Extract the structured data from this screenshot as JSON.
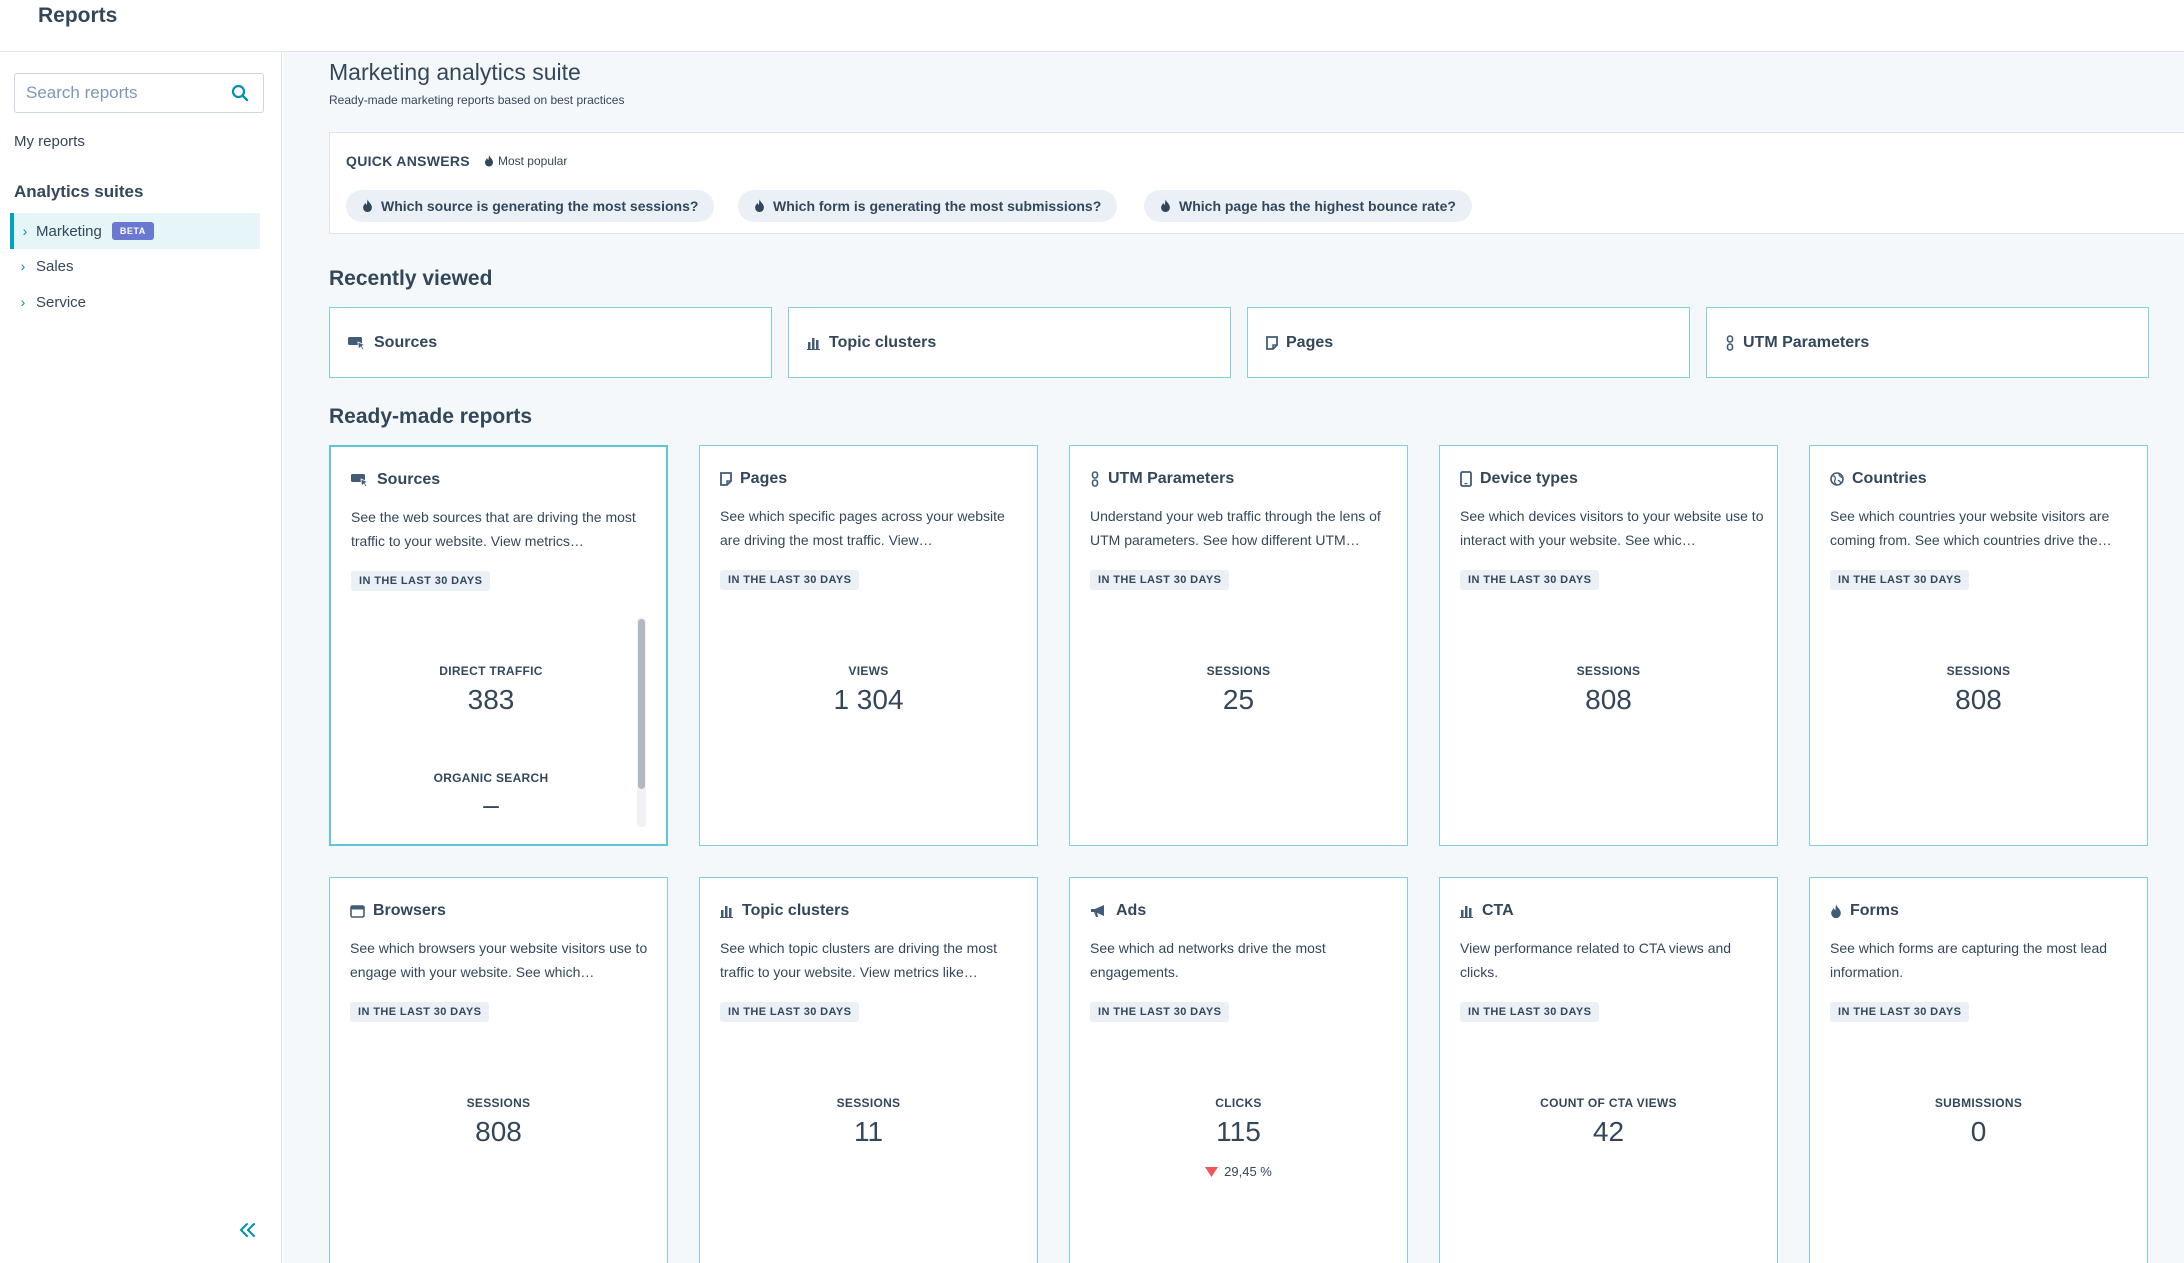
{
  "header": {
    "title": "Reports"
  },
  "sidebar": {
    "search_placeholder": "Search reports",
    "my_reports": "My reports",
    "suites_heading": "Analytics suites",
    "items": [
      {
        "label": "Marketing",
        "badge": "BETA"
      },
      {
        "label": "Sales"
      },
      {
        "label": "Service"
      }
    ]
  },
  "main": {
    "title": "Marketing analytics suite",
    "subtitle": "Ready-made marketing reports based on best practices",
    "quick_answers": {
      "heading": "QUICK ANSWERS",
      "popular": "Most popular",
      "chips": [
        "Which source is generating the most sessions?",
        "Which form is generating the most submissions?",
        "Which page has the highest bounce rate?"
      ]
    },
    "recently_viewed": {
      "heading": "Recently viewed",
      "items": [
        "Sources",
        "Topic clusters",
        "Pages",
        "UTM Parameters"
      ]
    },
    "ready_made": {
      "heading": "Ready-made reports",
      "period_badge": "IN THE LAST 30 DAYS",
      "cards": [
        {
          "icon": "sources-icon",
          "title": "Sources",
          "desc": "See the web sources that are driving the most traffic to your website. View metrics…",
          "metrics": [
            {
              "label": "DIRECT TRAFFIC",
              "value": "383"
            },
            {
              "label": "ORGANIC SEARCH",
              "value": "–"
            }
          ]
        },
        {
          "icon": "pages-icon",
          "title": "Pages",
          "desc": "See which specific pages across your website are driving the most traffic. View…",
          "metrics": [
            {
              "label": "VIEWS",
              "value": "1 304"
            }
          ]
        },
        {
          "icon": "utm-icon",
          "title": "UTM Parameters",
          "desc": "Understand your web traffic through the lens of UTM parameters. See how different UTM…",
          "metrics": [
            {
              "label": "SESSIONS",
              "value": "25"
            }
          ]
        },
        {
          "icon": "device-icon",
          "title": "Device types",
          "desc": "See which devices visitors to your website use to interact with your website. See whic…",
          "metrics": [
            {
              "label": "SESSIONS",
              "value": "808"
            }
          ]
        },
        {
          "icon": "globe-icon",
          "title": "Countries",
          "desc": "See which countries your website visitors are coming from. See which countries drive the…",
          "metrics": [
            {
              "label": "SESSIONS",
              "value": "808"
            }
          ]
        },
        {
          "icon": "browser-icon",
          "title": "Browsers",
          "desc": "See which browsers your website visitors use to engage with your website. See which…",
          "metrics": [
            {
              "label": "SESSIONS",
              "value": "808"
            }
          ]
        },
        {
          "icon": "bar-chart-icon",
          "title": "Topic clusters",
          "desc": "See which topic clusters are driving the most traffic to your website. View metrics like…",
          "metrics": [
            {
              "label": "SESSIONS",
              "value": "11"
            }
          ]
        },
        {
          "icon": "megaphone-icon",
          "title": "Ads",
          "desc": "See which ad networks drive the most engagements.",
          "metrics": [
            {
              "label": "CLICKS",
              "value": "115"
            }
          ],
          "trend": "29,45 %"
        },
        {
          "icon": "bar-chart-icon",
          "title": "CTA",
          "desc": "View performance related to CTA views and clicks.",
          "metrics": [
            {
              "label": "COUNT OF CTA VIEWS",
              "value": "42"
            }
          ]
        },
        {
          "icon": "flame-icon",
          "title": "Forms",
          "desc": "See which forms are capturing the most lead information.",
          "metrics": [
            {
              "label": "SUBMISSIONS",
              "value": "0"
            }
          ]
        }
      ]
    }
  },
  "colors": {
    "accent": "#00a4bd",
    "text": "#33475b",
    "card_border": "#7fd1de",
    "beta": "#6a78d1",
    "trend_down": "#f2545b"
  }
}
